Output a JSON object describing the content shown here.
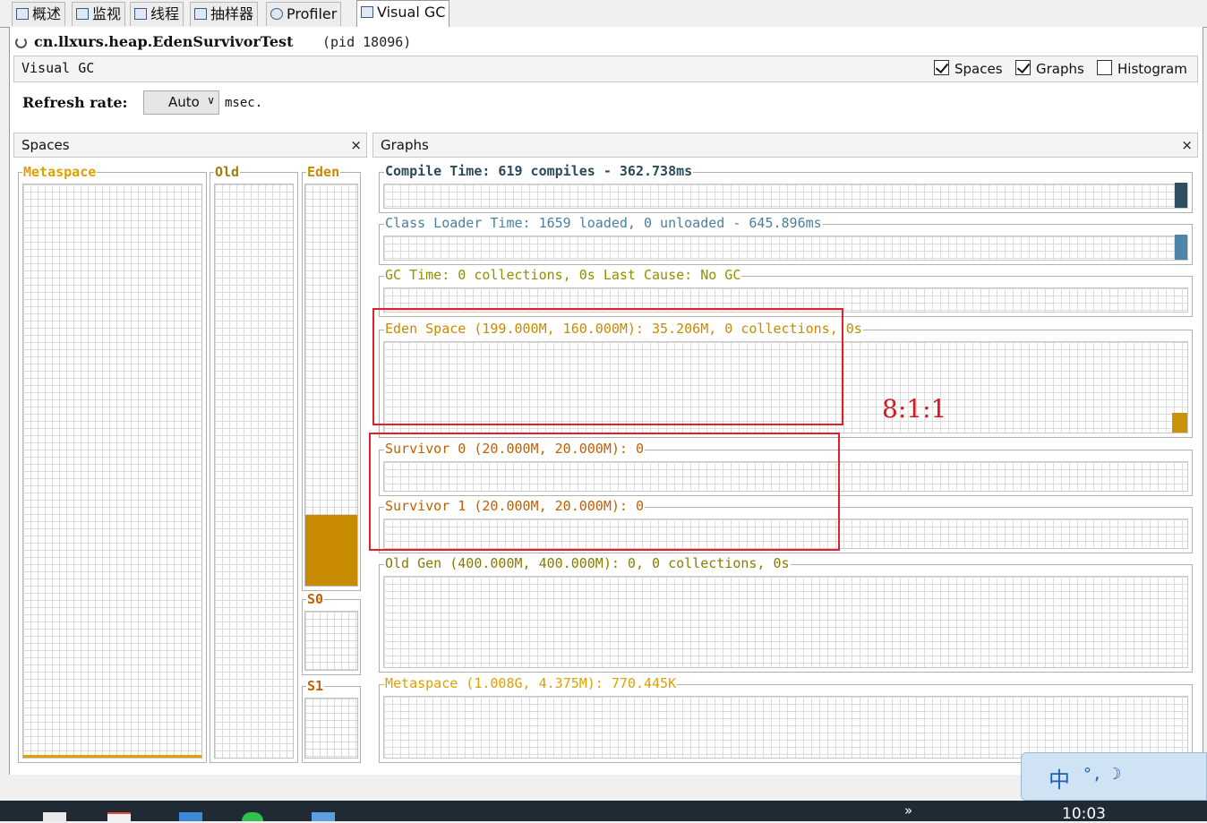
{
  "tabs": [
    {
      "label": "概述",
      "icon": "overview-icon",
      "active": false
    },
    {
      "label": "监视",
      "icon": "monitor-icon",
      "active": false
    },
    {
      "label": "线程",
      "icon": "threads-icon",
      "active": false
    },
    {
      "label": "抽样器",
      "icon": "sampler-icon",
      "active": false
    },
    {
      "label": "Profiler",
      "icon": "profiler-icon",
      "active": false
    },
    {
      "label": "Visual GC",
      "icon": "visualgc-icon",
      "active": true
    }
  ],
  "app": {
    "process_name": "cn.llxurs.heap.EdenSurvivorTest",
    "pid_text": "(pid 18096)"
  },
  "visual_gc": {
    "title": "Visual GC",
    "options": [
      {
        "label": "Spaces",
        "checked": true
      },
      {
        "label": "Graphs",
        "checked": true
      },
      {
        "label": "Histogram",
        "checked": false
      }
    ],
    "refresh_label": "Refresh rate:",
    "refresh_value": "Auto",
    "refresh_unit": "msec."
  },
  "spaces_panel": {
    "title": "Spaces",
    "close": "×",
    "metaspace": {
      "label": "Metaspace",
      "color": "#e0a000",
      "fill_fraction": 0.005
    },
    "old": {
      "label": "Old",
      "color": "#a08000",
      "fill_fraction": 0.0
    },
    "eden": {
      "label": "Eden",
      "color": "#c88a00",
      "fill_fraction": 0.177
    },
    "s0": {
      "label": "S0",
      "color": "#c06000",
      "fill_fraction": 0.0
    },
    "s1": {
      "label": "S1",
      "color": "#c06000",
      "fill_fraction": 0.0
    }
  },
  "graphs_panel": {
    "title": "Graphs",
    "close": "×",
    "rows": [
      {
        "text": "Compile Time: 619 compiles - 362.738ms",
        "color": "#2a4a5a",
        "bar_color": "#2f4f63"
      },
      {
        "text": "Class Loader Time: 1659 loaded, 0 unloaded - 645.896ms",
        "color": "#4a7fa0",
        "bar_color": "#4f86a8"
      },
      {
        "text": "GC Time: 0 collections, 0s Last Cause: No GC",
        "color": "#909000",
        "bar_color": "#909000"
      },
      {
        "text": "Eden Space (199.000M, 160.000M): 35.206M, 0 collections, 0s",
        "color": "#c88a00",
        "bar_color": "#c8920a"
      },
      {
        "text": "Survivor 0 (20.000M, 20.000M): 0",
        "color": "#c06000",
        "bar_color": "#c06000"
      },
      {
        "text": "Survivor 1 (20.000M, 20.000M): 0",
        "color": "#c06000",
        "bar_color": "#c06000"
      },
      {
        "text": "Old Gen (400.000M, 400.000M): 0, 0 collections, 0s",
        "color": "#8a7a00",
        "bar_color": "#8a7a00"
      },
      {
        "text": "Metaspace (1.008G, 4.375M): 770.445K",
        "color": "#e0a000",
        "bar_color": "#e0a000"
      }
    ]
  },
  "annotation": {
    "ratio_text": "8:1:1",
    "color": "#e0202a"
  },
  "ime": {
    "char": "中",
    "symbols": "°, ☽"
  },
  "taskbar": {
    "clock": "10:03",
    "overflow": "»"
  }
}
